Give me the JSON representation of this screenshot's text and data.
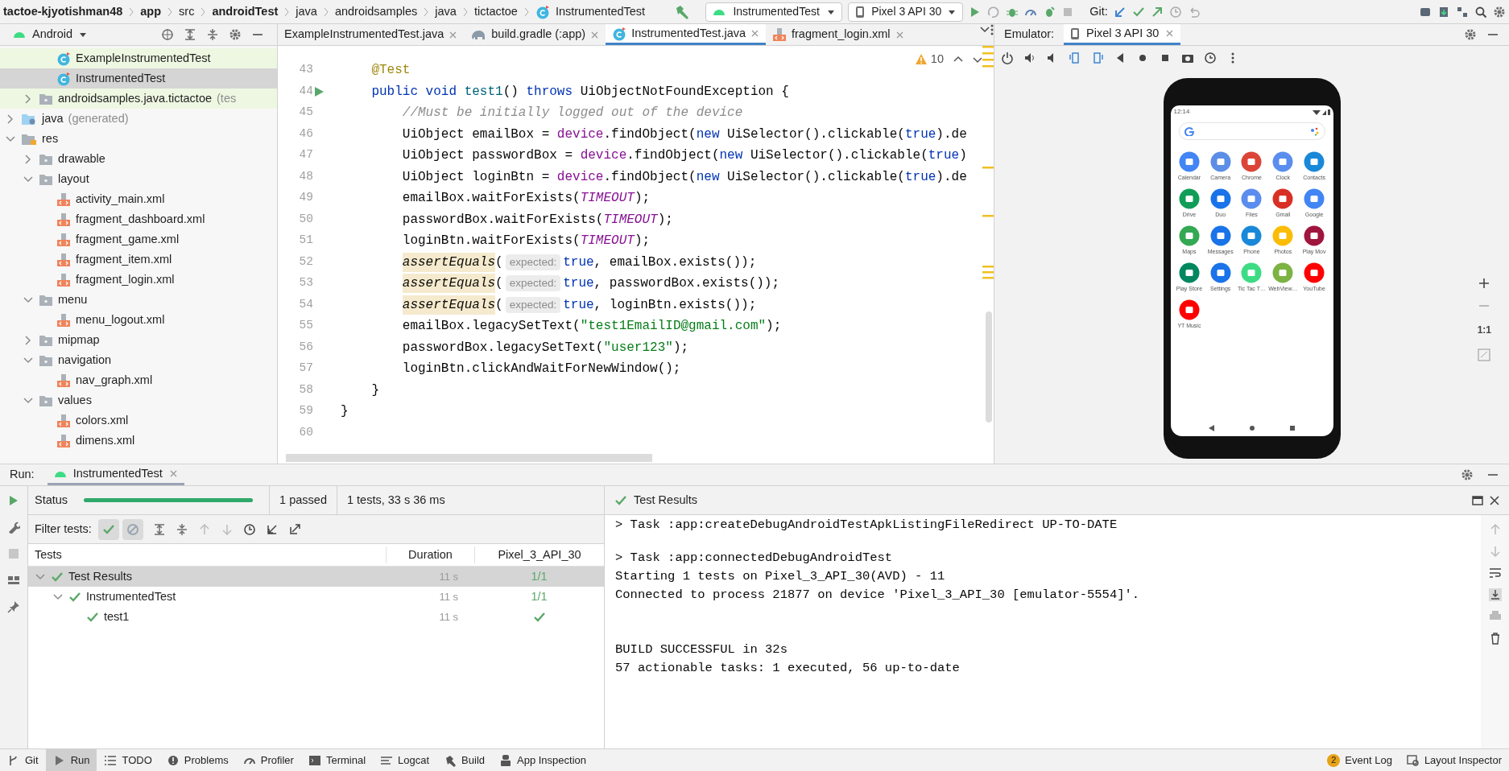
{
  "nav_bar": {
    "breadcrumbs": [
      {
        "text": "tactoe-kjyotishman48",
        "bold": true
      },
      {
        "text": "app",
        "bold": true
      },
      {
        "text": "src",
        "bold": false
      },
      {
        "text": "androidTest",
        "bold": true
      },
      {
        "text": "java",
        "bold": false
      },
      {
        "text": "androidsamples",
        "bold": false
      },
      {
        "text": "java",
        "bold": false
      },
      {
        "text": "tictactoe",
        "bold": false
      },
      {
        "text": "InstrumentedTest",
        "bold": false
      }
    ],
    "run_config": "InstrumentedTest",
    "device": "Pixel 3 API 30",
    "git_label": "Git:"
  },
  "project_panel": {
    "view": "Android",
    "tree": [
      {
        "children": [
          {
            "children": [
              {
                "label": "ExampleInstrumentedTest",
                "kind": "class",
                "selected": false,
                "test_source": true
              },
              {
                "label": "InstrumentedTest",
                "kind": "class",
                "selected": true
              }
            ]
          },
          {
            "label": "androidsamples.java.tictactoe",
            "suffix": "(tes",
            "kind": "folder",
            "expanded": false,
            "selected": false,
            "test_source": true
          }
        ]
      },
      {
        "label": "java",
        "suffix": "(generated)",
        "kind": "generated_folder",
        "expanded": false,
        "selected": false
      },
      {
        "label": "res",
        "kind": "res_folder",
        "expanded": true,
        "selected": false,
        "children": [
          {
            "label": "drawable",
            "kind": "folder",
            "expanded": false,
            "selected": false
          },
          {
            "label": "layout",
            "kind": "folder",
            "expanded": true,
            "selected": false,
            "children": [
              {
                "label": "activity_main.xml",
                "kind": "xml",
                "selected": false
              },
              {
                "label": "fragment_dashboard.xml",
                "kind": "xml",
                "selected": false
              },
              {
                "label": "fragment_game.xml",
                "kind": "xml",
                "selected": false
              },
              {
                "label": "fragment_item.xml",
                "kind": "xml",
                "selected": false
              },
              {
                "label": "fragment_login.xml",
                "kind": "xml",
                "selected": false
              }
            ]
          },
          {
            "label": "menu",
            "kind": "folder",
            "expanded": true,
            "selected": false,
            "children": [
              {
                "label": "menu_logout.xml",
                "kind": "xml",
                "selected": false
              }
            ]
          },
          {
            "label": "mipmap",
            "kind": "folder",
            "expanded": false,
            "selected": false
          },
          {
            "label": "navigation",
            "kind": "folder",
            "expanded": true,
            "selected": false,
            "children": [
              {
                "label": "nav_graph.xml",
                "kind": "xml",
                "selected": false
              }
            ]
          },
          {
            "label": "values",
            "kind": "folder",
            "expanded": true,
            "selected": false,
            "children": [
              {
                "label": "colors.xml",
                "kind": "xml",
                "selected": false
              },
              {
                "label": "dimens.xml",
                "kind": "xml",
                "selected": false
              }
            ]
          }
        ]
      }
    ]
  },
  "editor": {
    "tabs": [
      {
        "label": "ExampleInstrumentedTest.java",
        "kind": "class",
        "selected": false
      },
      {
        "label": "build.gradle (:app)",
        "kind": "gradle",
        "selected": false
      },
      {
        "label": "InstrumentedTest.java",
        "kind": "class",
        "selected": true
      },
      {
        "label": "fragment_login.xml",
        "kind": "xml",
        "selected": false
      }
    ],
    "warning_count": "10",
    "lines": [
      {
        "number": "43",
        "tokens": [
          {
            "text": "    @Test",
            "kind": "annotation"
          }
        ]
      },
      {
        "number": "44",
        "run_marker": true,
        "tokens": [
          {
            "text": "    public void ",
            "kind": "keyword"
          },
          {
            "text": "test1",
            "kind": "method"
          },
          {
            "text": "() ",
            "kind": "plain"
          },
          {
            "text": "throws ",
            "kind": "keyword"
          },
          {
            "text": "UiObjectNotFoundException {",
            "kind": "plain"
          }
        ]
      },
      {
        "number": "45",
        "tokens": [
          {
            "text": "        //Must be initially logged out of the device",
            "kind": "comment"
          }
        ]
      },
      {
        "number": "46",
        "tokens": [
          {
            "text": "        UiObject emailBox = ",
            "kind": "plain"
          },
          {
            "text": "device",
            "kind": "field"
          },
          {
            "text": ".findObject(",
            "kind": "plain"
          },
          {
            "text": "new ",
            "kind": "keyword"
          },
          {
            "text": "UiSelector().clickable(",
            "kind": "plain"
          },
          {
            "text": "true",
            "kind": "keyword"
          },
          {
            "text": ").de",
            "kind": "plain"
          }
        ]
      },
      {
        "number": "47",
        "tokens": [
          {
            "text": "        UiObject passwordBox = ",
            "kind": "plain"
          },
          {
            "text": "device",
            "kind": "field"
          },
          {
            "text": ".findObject(",
            "kind": "plain"
          },
          {
            "text": "new ",
            "kind": "keyword"
          },
          {
            "text": "UiSelector().clickable(",
            "kind": "plain"
          },
          {
            "text": "true",
            "kind": "keyword"
          },
          {
            "text": ")",
            "kind": "plain"
          }
        ]
      },
      {
        "number": "48",
        "tokens": [
          {
            "text": "        UiObject loginBtn = ",
            "kind": "plain"
          },
          {
            "text": "device",
            "kind": "field"
          },
          {
            "text": ".findObject(",
            "kind": "plain"
          },
          {
            "text": "new ",
            "kind": "keyword"
          },
          {
            "text": "UiSelector().clickable(",
            "kind": "plain"
          },
          {
            "text": "true",
            "kind": "keyword"
          },
          {
            "text": ").de",
            "kind": "plain"
          }
        ]
      },
      {
        "number": "49",
        "tokens": [
          {
            "text": "        emailBox.waitForExists(",
            "kind": "plain"
          },
          {
            "text": "TIMEOUT",
            "kind": "constant"
          },
          {
            "text": ");",
            "kind": "plain"
          }
        ]
      },
      {
        "number": "50",
        "tokens": [
          {
            "text": "        passwordBox.waitForExists(",
            "kind": "plain"
          },
          {
            "text": "TIMEOUT",
            "kind": "constant"
          },
          {
            "text": ");",
            "kind": "plain"
          }
        ]
      },
      {
        "number": "51",
        "tokens": [
          {
            "text": "        loginBtn.waitForExists(",
            "kind": "plain"
          },
          {
            "text": "TIMEOUT",
            "kind": "constant"
          },
          {
            "text": ");",
            "kind": "plain"
          }
        ]
      },
      {
        "number": "52",
        "tokens": [
          {
            "text": "        assertEquals",
            "kind": "assert"
          },
          {
            "text": "(",
            "kind": "plain"
          },
          {
            "text": "expected:",
            "kind": "hint"
          },
          {
            "text": "true",
            "kind": "keyword"
          },
          {
            "text": ", emailBox.exists());",
            "kind": "plain"
          }
        ]
      },
      {
        "number": "53",
        "tokens": [
          {
            "text": "        assertEquals",
            "kind": "assert"
          },
          {
            "text": "(",
            "kind": "plain"
          },
          {
            "text": "expected:",
            "kind": "hint"
          },
          {
            "text": "true",
            "kind": "keyword"
          },
          {
            "text": ", passwordBox.exists());",
            "kind": "plain"
          }
        ]
      },
      {
        "number": "54",
        "tokens": [
          {
            "text": "        assertEquals",
            "kind": "assert"
          },
          {
            "text": "(",
            "kind": "plain"
          },
          {
            "text": "expected:",
            "kind": "hint"
          },
          {
            "text": "true",
            "kind": "keyword"
          },
          {
            "text": ", loginBtn.exists());",
            "kind": "plain"
          }
        ]
      },
      {
        "number": "55",
        "tokens": [
          {
            "text": "        emailBox.legacySetText(",
            "kind": "plain"
          },
          {
            "text": "\"test1EmailID@gmail.com\"",
            "kind": "string"
          },
          {
            "text": ");",
            "kind": "plain"
          }
        ]
      },
      {
        "number": "56",
        "tokens": [
          {
            "text": "        passwordBox.legacySetText(",
            "kind": "plain"
          },
          {
            "text": "\"user123\"",
            "kind": "string"
          },
          {
            "text": ");",
            "kind": "plain"
          }
        ]
      },
      {
        "number": "57",
        "tokens": [
          {
            "text": "        loginBtn.clickAndWaitForNewWindow();",
            "kind": "plain"
          }
        ]
      },
      {
        "number": "58",
        "tokens": [
          {
            "text": "    }",
            "kind": "plain"
          }
        ]
      },
      {
        "number": "59",
        "tokens": [
          {
            "text": "}",
            "kind": "plain"
          }
        ]
      },
      {
        "number": "60"
      }
    ]
  },
  "emulator": {
    "title": "Emulator:",
    "tab": "Pixel 3 API 30",
    "zoom_ratio": "1:1",
    "phone": {
      "time": "12:14",
      "apps": [
        {
          "label": "Calendar",
          "color": "#4285f4"
        },
        {
          "label": "Camera",
          "color": "#5c8ee6"
        },
        {
          "label": "Chrome",
          "color": "#db4437"
        },
        {
          "label": "Clock",
          "color": "#5b8def"
        },
        {
          "label": "Contacts",
          "color": "#1a88d8"
        },
        {
          "label": "Drive",
          "color": "#0f9d58"
        },
        {
          "label": "Duo",
          "color": "#1a73e8"
        },
        {
          "label": "Files",
          "color": "#5b8def"
        },
        {
          "label": "Gmail",
          "color": "#d93025"
        },
        {
          "label": "Google",
          "color": "#4285f4"
        },
        {
          "label": "Maps",
          "color": "#34a853"
        },
        {
          "label": "Messages",
          "color": "#1a73e8"
        },
        {
          "label": "Phone",
          "color": "#1a88d8"
        },
        {
          "label": "Photos",
          "color": "#fbbc05"
        },
        {
          "label": "Play Mov",
          "color": "#a0153e"
        },
        {
          "label": "Play Store",
          "color": "#01875f"
        },
        {
          "label": "Settings",
          "color": "#1a73e8"
        },
        {
          "label": "Tic Tac T…",
          "color": "#3ddc84"
        },
        {
          "label": "WebView…",
          "color": "#7cb342"
        },
        {
          "label": "YouTube",
          "color": "#ff0000"
        },
        {
          "label": "YT Music",
          "color": "#ff0000"
        }
      ]
    }
  },
  "run_panel": {
    "title": "Run:",
    "tab": "InstrumentedTest",
    "status_label": "Status",
    "progress": {
      "level": 1
    },
    "passed": "1 passed",
    "summary": "1 tests, 33 s 36 ms",
    "filter_label": "Filter tests:",
    "table": {
      "columns": [
        "Tests",
        "Duration",
        "Pixel_3_API_30"
      ],
      "rows": [
        {
          "name": "Test Results",
          "duration": "11 s",
          "result": "1/1",
          "passed": true,
          "expanded": true,
          "selected": true,
          "children": [
            {
              "name": "InstrumentedTest",
              "duration": "11 s",
              "result": "1/1",
              "passed": true,
              "expanded": true,
              "selected": false,
              "children": [
                {
                  "name": "test1",
                  "duration": "11 s",
                  "passed": true,
                  "selected": false
                }
              ]
            }
          ]
        }
      ]
    },
    "console": {
      "title": "Test Results",
      "blocks": [
        [
          "> Task :app:createDebugAndroidTestApkListingFileRedirect UP-TO-DATE"
        ],
        [
          "> Task :app:connectedDebugAndroidTest",
          "Starting 1 tests on Pixel_3_API_30(AVD) - 11",
          "Connected to process 21877 on device 'Pixel_3_API_30 [emulator-5554]'."
        ],
        [
          "BUILD SUCCESSFUL in 32s",
          "57 actionable tasks: 1 executed, 56 up-to-date"
        ]
      ]
    }
  },
  "bottom_bar": {
    "left": [
      {
        "label": "Git",
        "kind": "git",
        "selected": false
      },
      {
        "label": "Run",
        "kind": "run",
        "selected": true
      },
      {
        "label": "TODO",
        "kind": "todo",
        "selected": false
      },
      {
        "label": "Problems",
        "kind": "problems",
        "selected": false
      },
      {
        "label": "Profiler",
        "kind": "profiler",
        "selected": false
      },
      {
        "label": "Terminal",
        "kind": "terminal",
        "selected": false
      },
      {
        "label": "Logcat",
        "kind": "logcat",
        "selected": false
      },
      {
        "label": "Build",
        "kind": "build",
        "selected": false
      },
      {
        "label": "App Inspection",
        "kind": "inspection",
        "selected": false
      }
    ],
    "right": [
      {
        "label": "Event Log",
        "badge": "2",
        "kind": "eventlog",
        "selected": false
      },
      {
        "label": "Layout Inspector",
        "kind": "layout",
        "selected": false
      }
    ]
  }
}
